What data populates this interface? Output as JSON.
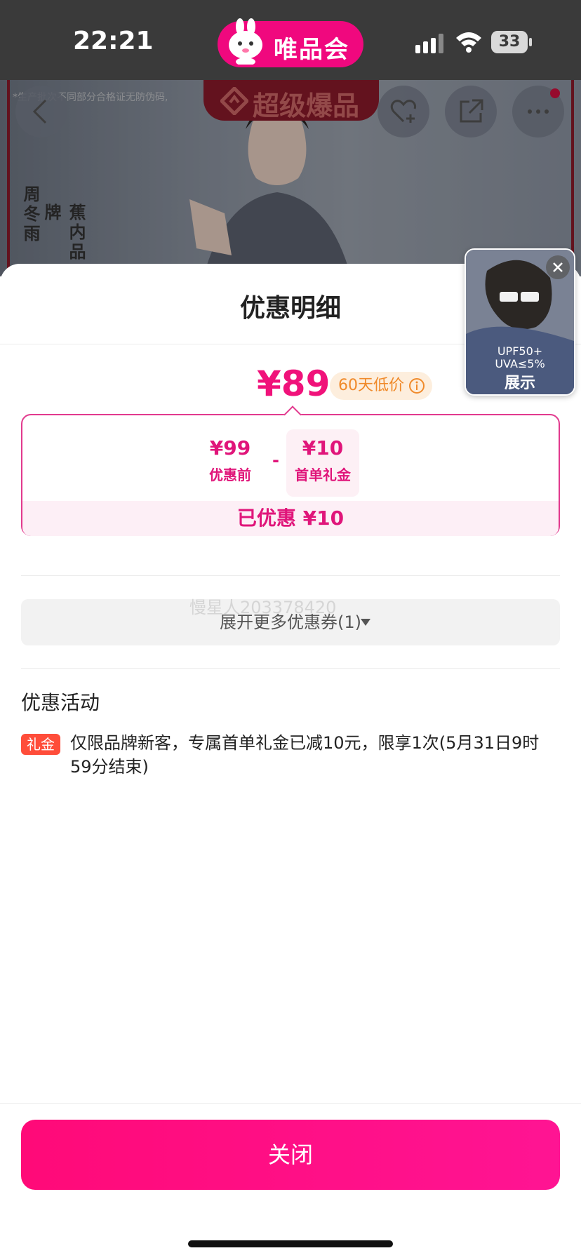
{
  "status_bar": {
    "time": "22:21",
    "app_name": "唯品会",
    "battery": "33"
  },
  "background": {
    "disclaimer": "*生产批次不同部分合格证无防伪码,",
    "campaign": "超级爆品",
    "side_caption_1": "周冬雨",
    "side_caption_2": "蕉内品牌"
  },
  "sheet": {
    "title": "优惠明细",
    "final_price": "¥89",
    "low_price_badge": "60天低价",
    "calculation": {
      "original_amount": "¥99",
      "original_label": "优惠前",
      "minus": "-",
      "discount_amount": "¥10",
      "discount_label": "首单礼金"
    },
    "saved_label": "已优惠 ¥10",
    "watermark": "慢星人203378420",
    "expand_label": "展开更多优惠券(1)",
    "activity_section_title": "优惠活动",
    "activity_badge": "礼金",
    "activity_text": "仅限品牌新客，专属首单礼金已减10元，限享1次(5月31日9时59分结束)",
    "close_label": "关闭"
  },
  "float_video": {
    "line_1": "UPF50+",
    "line_2": "UVA≤5%",
    "label": "展示"
  },
  "colors": {
    "brand_pink": "#f0087e",
    "price_pink": "#f0127a",
    "badge_orange": "#f08a2a",
    "gift_red": "#ff4d3a"
  },
  "icons": [
    "back-chevron-icon",
    "heart-add-icon",
    "share-icon",
    "more-icon",
    "info-icon",
    "caret-down-icon",
    "close-icon",
    "signal-icon",
    "wifi-icon",
    "battery-icon"
  ]
}
